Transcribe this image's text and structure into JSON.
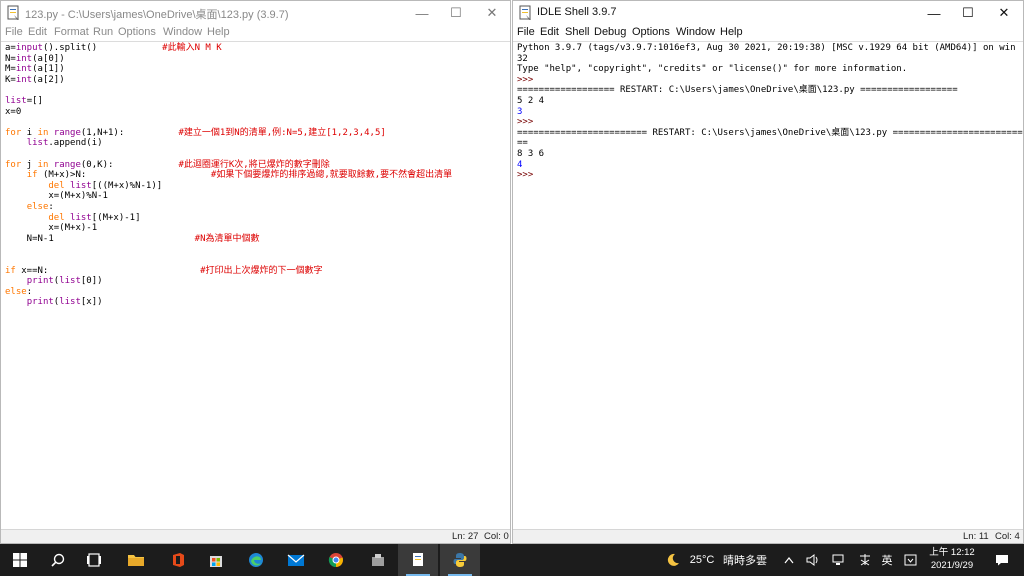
{
  "editor": {
    "title": "123.py - C:\\Users\\james\\OneDrive\\桌面\\123.py (3.9.7)",
    "menu": [
      "File",
      "Edit",
      "Format",
      "Run",
      "Options",
      "Window",
      "Help"
    ],
    "code_lines": [
      [
        {
          "t": "a=",
          "c": ""
        },
        {
          "t": "input",
          "c": "bi"
        },
        {
          "t": "().split()            ",
          "c": ""
        },
        {
          "t": "#此輸入N M K",
          "c": "cm"
        }
      ],
      [
        {
          "t": "N=",
          "c": ""
        },
        {
          "t": "int",
          "c": "bi"
        },
        {
          "t": "(a[0])",
          "c": ""
        }
      ],
      [
        {
          "t": "M=",
          "c": ""
        },
        {
          "t": "int",
          "c": "bi"
        },
        {
          "t": "(a[1])",
          "c": ""
        }
      ],
      [
        {
          "t": "K=",
          "c": ""
        },
        {
          "t": "int",
          "c": "bi"
        },
        {
          "t": "(a[2])",
          "c": ""
        }
      ],
      [],
      [
        {
          "t": "list",
          "c": "bi"
        },
        {
          "t": "=[]",
          "c": ""
        }
      ],
      [
        {
          "t": "x=0",
          "c": ""
        }
      ],
      [],
      [
        {
          "t": "for",
          "c": "kw"
        },
        {
          "t": " i ",
          "c": ""
        },
        {
          "t": "in",
          "c": "kw"
        },
        {
          "t": " ",
          "c": ""
        },
        {
          "t": "range",
          "c": "bi"
        },
        {
          "t": "(1,N+1):          ",
          "c": ""
        },
        {
          "t": "#建立一個1到N的清單,例:N=5,建立[1,2,3,4,5]",
          "c": "cm"
        }
      ],
      [
        {
          "t": "    ",
          "c": ""
        },
        {
          "t": "list",
          "c": "bi"
        },
        {
          "t": ".append(i)",
          "c": ""
        }
      ],
      [],
      [
        {
          "t": "for",
          "c": "kw"
        },
        {
          "t": " j ",
          "c": ""
        },
        {
          "t": "in",
          "c": "kw"
        },
        {
          "t": " ",
          "c": ""
        },
        {
          "t": "range",
          "c": "bi"
        },
        {
          "t": "(0,K):            ",
          "c": ""
        },
        {
          "t": "#此迴圈運行K次,將已爆炸的數字刪除",
          "c": "cm"
        }
      ],
      [
        {
          "t": "    ",
          "c": ""
        },
        {
          "t": "if",
          "c": "kw"
        },
        {
          "t": " (M+x)>N:                       ",
          "c": ""
        },
        {
          "t": "#如果下個要爆炸的排序過總,就要取餘數,要不然會超出清單",
          "c": "cm"
        }
      ],
      [
        {
          "t": "        ",
          "c": ""
        },
        {
          "t": "del",
          "c": "kw"
        },
        {
          "t": " ",
          "c": ""
        },
        {
          "t": "list",
          "c": "bi"
        },
        {
          "t": "[((M+x)%N-1)]",
          "c": ""
        }
      ],
      [
        {
          "t": "        x=(M+x)%N-1",
          "c": ""
        }
      ],
      [
        {
          "t": "    ",
          "c": ""
        },
        {
          "t": "else",
          "c": "kw"
        },
        {
          "t": ":",
          "c": ""
        }
      ],
      [
        {
          "t": "        ",
          "c": ""
        },
        {
          "t": "del",
          "c": "kw"
        },
        {
          "t": " ",
          "c": ""
        },
        {
          "t": "list",
          "c": "bi"
        },
        {
          "t": "[(M+x)-1]",
          "c": ""
        }
      ],
      [
        {
          "t": "        x=(M+x)-1",
          "c": ""
        }
      ],
      [
        {
          "t": "    N=N-1                          ",
          "c": ""
        },
        {
          "t": "#N為清單中個數",
          "c": "cm"
        }
      ],
      [],
      [],
      [
        {
          "t": "if",
          "c": "kw"
        },
        {
          "t": " x==N:                            ",
          "c": ""
        },
        {
          "t": "#打印出上次爆炸的下一個數字",
          "c": "cm"
        }
      ],
      [
        {
          "t": "    ",
          "c": ""
        },
        {
          "t": "print",
          "c": "bi"
        },
        {
          "t": "(",
          "c": ""
        },
        {
          "t": "list",
          "c": "bi"
        },
        {
          "t": "[0])",
          "c": ""
        }
      ],
      [
        {
          "t": "else",
          "c": "kw"
        },
        {
          "t": ":",
          "c": ""
        }
      ],
      [
        {
          "t": "    ",
          "c": ""
        },
        {
          "t": "print",
          "c": "bi"
        },
        {
          "t": "(",
          "c": ""
        },
        {
          "t": "list",
          "c": "bi"
        },
        {
          "t": "[x])",
          "c": ""
        }
      ]
    ],
    "status": {
      "line": "Ln: 27",
      "col": "Col: 0"
    }
  },
  "shell": {
    "title": "IDLE Shell 3.9.7",
    "menu": [
      "File",
      "Edit",
      "Shell",
      "Debug",
      "Options",
      "Window",
      "Help"
    ],
    "lines": [
      {
        "t": "Python 3.9.7 (tags/v3.9.7:1016ef3, Aug 30 2021, 20:19:38) [MSC v.1929 64 bit (AMD64)] on win",
        "c": ""
      },
      {
        "t": "32",
        "c": ""
      },
      {
        "t": "Type \"help\", \"copyright\", \"credits\" or \"license()\" for more information.",
        "c": ""
      },
      {
        "t": ">>>",
        "c": "pr"
      },
      {
        "t": "================== RESTART: C:\\Users\\james\\OneDrive\\桌面\\123.py ==================",
        "c": ""
      },
      {
        "t": "5 2 4",
        "c": ""
      },
      {
        "t": "3",
        "c": "out"
      },
      {
        "t": ">>>",
        "c": "pr"
      },
      {
        "t": "======================== RESTART: C:\\Users\\james\\OneDrive\\桌面\\123.py ========================",
        "c": ""
      },
      {
        "t": "==",
        "c": ""
      },
      {
        "t": "8 3 6",
        "c": ""
      },
      {
        "t": "4",
        "c": "out"
      },
      {
        "t": ">>>",
        "c": "pr"
      }
    ],
    "status": {
      "line": "Ln: 11",
      "col": "Col: 4"
    }
  },
  "taskbar": {
    "weather_temp": "25°C",
    "weather_desc": "晴時多雲",
    "ime": "英",
    "time": "上午 12:12",
    "date": "2021/9/29"
  },
  "colors": {
    "keyword": "#ff7700",
    "builtin": "#900090",
    "comment": "#dd0000",
    "output": "#0000ff",
    "taskbar_bg": "#1c1c1c"
  }
}
